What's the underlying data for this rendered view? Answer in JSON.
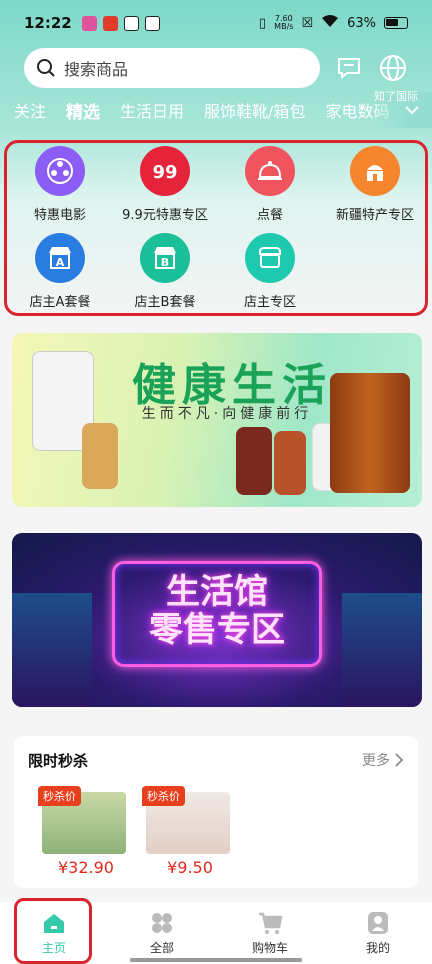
{
  "status_bar": {
    "time": "12:22",
    "net_speed_value": "7.60",
    "net_speed_unit": "MB/s",
    "battery": "63%"
  },
  "search": {
    "placeholder": "搜索商品"
  },
  "tabs": [
    {
      "label": "关注",
      "active": false
    },
    {
      "label": "精选",
      "active": true
    },
    {
      "label": "生活日用",
      "active": false
    },
    {
      "label": "服饰鞋靴/箱包",
      "active": false
    },
    {
      "label": "家电数码",
      "active": false
    }
  ],
  "tabs_overlay_text": "知了国际",
  "quick_nav": [
    {
      "label": "特惠电影",
      "icon": "film-reel-icon",
      "color": "#8b5cf6"
    },
    {
      "label": "9.9元特惠专区",
      "icon": "price-99-icon",
      "color": "#e5233a"
    },
    {
      "label": "点餐",
      "icon": "cloche-icon",
      "color": "#f0555f"
    },
    {
      "label": "新疆特产专区",
      "icon": "mosque-icon",
      "color": "#f5862e"
    },
    {
      "label": "店主A套餐",
      "icon": "store-a-icon",
      "color": "#2a7de0"
    },
    {
      "label": "店主B套餐",
      "icon": "store-b-icon",
      "color": "#1bbf9a"
    },
    {
      "label": "店主专区",
      "icon": "store-icon",
      "color": "#1ec9b0"
    }
  ],
  "banners": {
    "health": {
      "title": "健康生活",
      "subtitle": "生而不凡·向健康前行"
    },
    "store": {
      "title_line1": "生活馆",
      "title_line2": "零售专区"
    }
  },
  "flash_sale": {
    "title": "限时秒杀",
    "more": "更多",
    "items": [
      {
        "tag": "秒杀价",
        "price": "¥32.90"
      },
      {
        "tag": "秒杀价",
        "price": "¥9.50"
      }
    ]
  },
  "bottom_nav": [
    {
      "label": "主页",
      "icon": "home-icon",
      "active": true
    },
    {
      "label": "全部",
      "icon": "grid-icon",
      "active": false
    },
    {
      "label": "购物车",
      "icon": "cart-icon",
      "active": false
    },
    {
      "label": "我的",
      "icon": "user-icon",
      "active": false
    }
  ],
  "colors": {
    "accent": "#35c9a9",
    "price_red": "#e0291c",
    "highlight_red": "#d9232d"
  }
}
